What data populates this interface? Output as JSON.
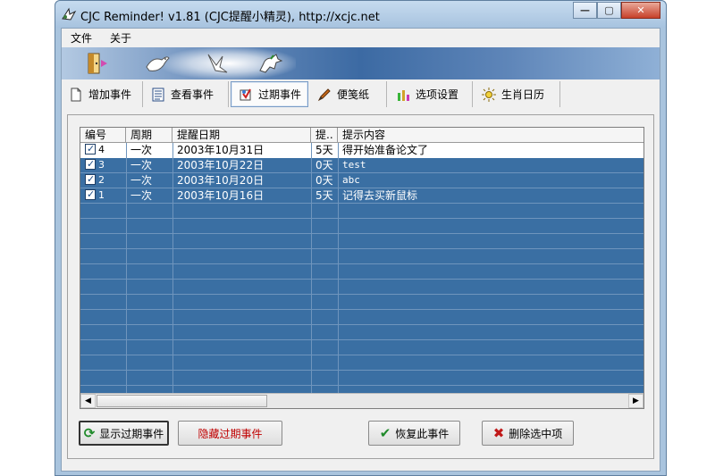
{
  "window": {
    "title": "CJC Reminder! v1.81 (CJC提醒小精灵),  http://xcjc.net",
    "minimize_icon": "minimize-icon",
    "maximize_icon": "maximize-icon",
    "close_icon": "close-icon"
  },
  "menu": {
    "items": [
      "文件",
      "关于"
    ]
  },
  "banner": {
    "icons": [
      "door-icon",
      "dove-icon",
      "bird-icon",
      "horse-icon"
    ]
  },
  "tabs": [
    {
      "label": "增加事件",
      "icon": "new-document-icon"
    },
    {
      "label": "查看事件",
      "icon": "list-icon"
    },
    {
      "label": "过期事件",
      "icon": "expired-icon",
      "active": true
    },
    {
      "label": "便笺纸",
      "icon": "pencil-icon"
    },
    {
      "label": "选项设置",
      "icon": "settings-icon"
    },
    {
      "label": "生肖日历",
      "icon": "sun-icon"
    }
  ],
  "grid": {
    "columns": [
      "编号",
      "周期",
      "提醒日期",
      "提..",
      "提示内容"
    ],
    "rows": [
      {
        "id": "4",
        "cycle": "一次",
        "date": "2003年10月31日",
        "advance": "5天",
        "content": "得开始准备论文了",
        "checked": true,
        "selected": false
      },
      {
        "id": "3",
        "cycle": "一次",
        "date": "2003年10月22日",
        "advance": "0天",
        "content": "test",
        "checked": true,
        "selected": true
      },
      {
        "id": "2",
        "cycle": "一次",
        "date": "2003年10月20日",
        "advance": "0天",
        "content": "abc",
        "checked": true,
        "selected": true
      },
      {
        "id": "1",
        "cycle": "一次",
        "date": "2003年10月16日",
        "advance": "5天",
        "content": "记得去买新鼠标",
        "checked": true,
        "selected": true
      }
    ]
  },
  "buttons": {
    "show_expired": "显示过期事件",
    "hide_expired": "隐藏过期事件",
    "restore": "恢复此事件",
    "delete_selected": "删除选中项"
  },
  "colors": {
    "selection": "#3a6fa3",
    "hide_text": "#c00000"
  }
}
